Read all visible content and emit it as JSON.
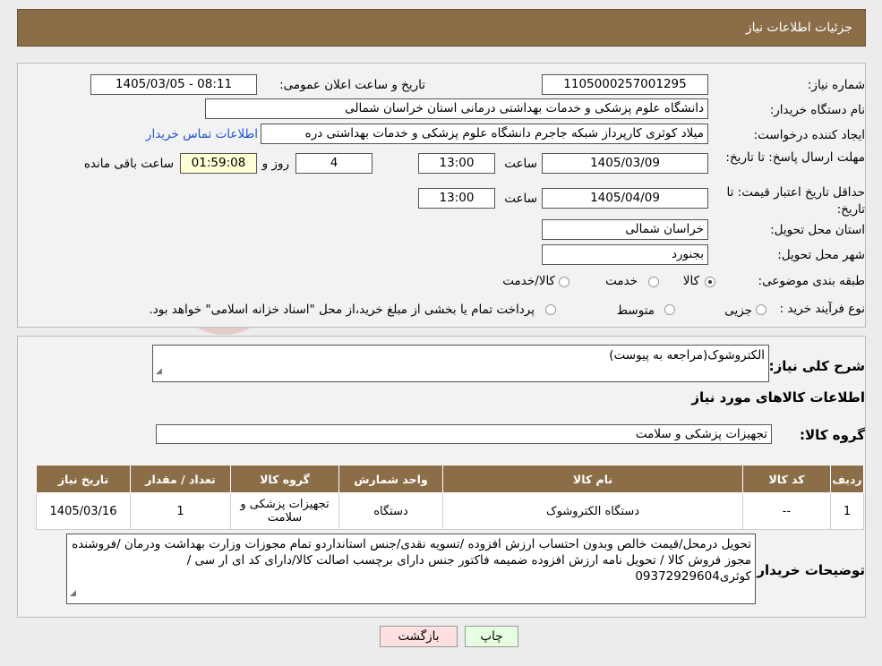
{
  "header": {
    "title": "جزئیات اطلاعات نیاز"
  },
  "fields": {
    "need_number_label": "شماره نیاز:",
    "need_number": "1105000257001295",
    "announce_label": "تاریخ و ساعت اعلان عمومی:",
    "announce_value": "1405/03/05 - 08:11",
    "buyer_org_label": "نام دستگاه خریدار:",
    "buyer_org": "دانشگاه علوم پزشکی و خدمات بهداشتی درمانی استان خراسان شمالی",
    "creator_label": "ایجاد کننده درخواست:",
    "creator": "میلاد کوثری کارپرداز شبکه جاجرم دانشگاه علوم پزشکی و خدمات بهداشتی دره",
    "contact_link": "اطلاعات تماس خریدار",
    "deadline_label": "مهلت ارسال پاسخ: تا تاریخ:",
    "deadline_date": "1405/03/09",
    "time_label": "ساعت",
    "deadline_time": "13:00",
    "days_value": "4",
    "days_label": "روز و",
    "remaining_time": "01:59:08",
    "remaining_label": "ساعت باقی مانده",
    "validity_label": "حداقل تاریخ اعتبار قیمت: تا تاریخ:",
    "validity_date": "1405/04/09",
    "validity_time": "13:00",
    "province_label": "استان محل تحویل:",
    "province": "خراسان شمالی",
    "city_label": "شهر محل تحویل:",
    "city": "بجنورد",
    "category_label": "طبقه بندی موضوعی:",
    "category_options": [
      "کالا",
      "خدمت",
      "کالا/خدمت"
    ],
    "category_selected": "کالا",
    "process_label": "نوع فرآیند خرید :",
    "process_options": [
      "جزیی",
      "متوسط"
    ],
    "process_note": "پرداخت تمام یا بخشی از مبلغ خرید،از محل \"اسناد خزانه اسلامی\" خواهد بود."
  },
  "description": {
    "label": "شرح کلی نیاز:",
    "value": "الکتروشوک(مراجعه به پیوست)"
  },
  "goods": {
    "section_title": "اطلاعات کالاهای مورد نیاز",
    "group_label": "گروه کالا:",
    "group_value": "تجهیزات پزشکی و سلامت",
    "columns": [
      "ردیف",
      "کد کالا",
      "نام کالا",
      "واحد شمارش",
      "گروه کالا",
      "تعداد / مقدار",
      "تاریخ نیاز"
    ],
    "rows": [
      [
        "1",
        "--",
        "دستگاه الکتروشوک",
        "دستگاه",
        "تجهیزات پزشکی و سلامت",
        "1",
        "1405/03/16"
      ]
    ]
  },
  "buyer_notes": {
    "label": "توضیحات خریدار:",
    "value": "تحویل درمحل/قیمت خالص وبدون احتساب ارزش افزوده /تسویه نقدی/جنس استانداردو تمام مجوزات وزارت بهداشت  ودرمان /فروشنده مجوز فروش کالا / تحویل  نامه ارزش افزوده ضمیمه  فاکتور جنس دارای برچسب اصالت کالا/دارای کد ای ار سی / کوثری09372929604"
  },
  "buttons": {
    "print": "چاپ",
    "back": "بازگشت"
  },
  "colors": {
    "header": "#8b6e48",
    "link": "#2255cc",
    "back_button": "#ffe0e0",
    "print_button": "#e6ffe0"
  }
}
